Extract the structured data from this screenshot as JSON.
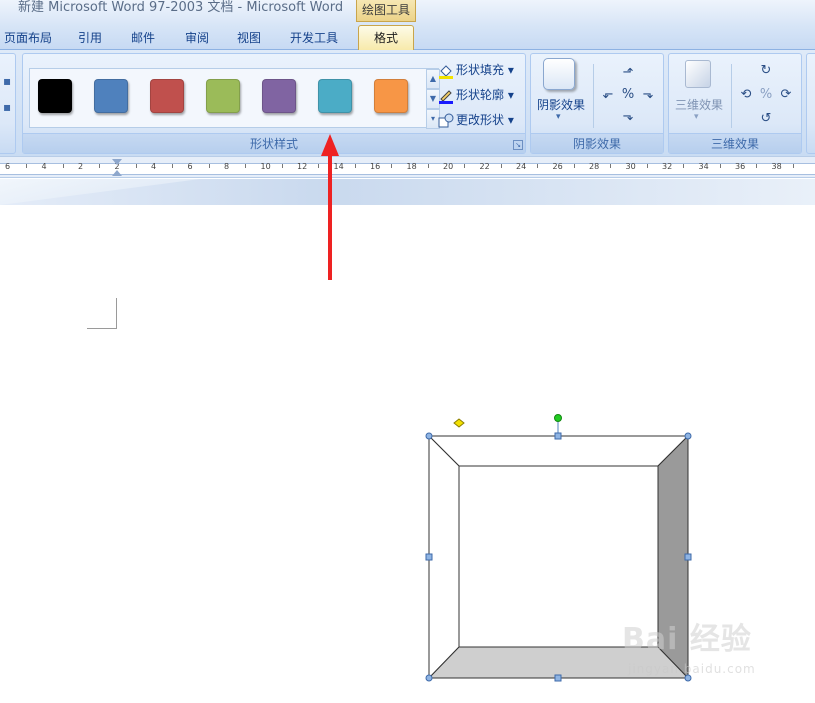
{
  "window": {
    "title": "新建 Microsoft Word 97-2003 文档 - Microsoft Word",
    "context_tab_group": "绘图工具"
  },
  "tabs": [
    {
      "label": "页面布局",
      "active": false
    },
    {
      "label": "引用",
      "active": false
    },
    {
      "label": "邮件",
      "active": false
    },
    {
      "label": "审阅",
      "active": false
    },
    {
      "label": "视图",
      "active": false
    },
    {
      "label": "开发工具",
      "active": false
    },
    {
      "label": "格式",
      "active": true
    }
  ],
  "ribbon": {
    "shape_styles": {
      "group_label": "形状样式",
      "swatches": [
        "#000000",
        "#4f81bd",
        "#c0504d",
        "#9bbb59",
        "#8064a2",
        "#4bacc6",
        "#f79646"
      ],
      "fill_label": "形状填充",
      "outline_label": "形状轮廓",
      "change_shape_label": "更改形状"
    },
    "shadow_effects": {
      "group_label": "阴影效果",
      "button_label": "阴影效果"
    },
    "three_d_effects": {
      "group_label": "三维效果",
      "button_label": "三维效果"
    }
  },
  "ruler": {
    "labels": [
      "6",
      "4",
      "2",
      "2",
      "4",
      "6",
      "8",
      "10",
      "12",
      "14",
      "16",
      "18",
      "20",
      "22",
      "24",
      "26",
      "28",
      "30",
      "32",
      "34",
      "36",
      "38"
    ]
  },
  "colors": {
    "accent_arrow": "#ee2222",
    "shape_dark_side": "#9a9a9a",
    "shape_light_side": "#cfcfcf",
    "handle": "#4f81bd",
    "rotate_handle": "#22cc22",
    "adjust_handle": "#f3e000"
  },
  "watermark": {
    "brand": "Bai 经验",
    "sub": "jingyan.baidu.com"
  }
}
